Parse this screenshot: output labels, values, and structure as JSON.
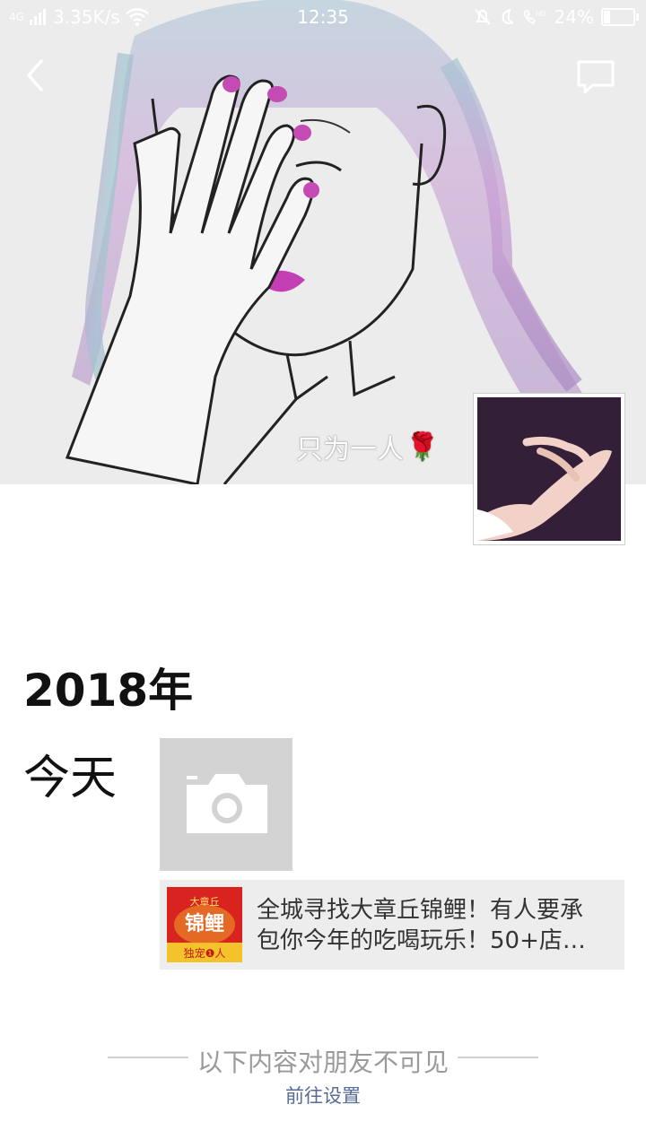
{
  "status_bar": {
    "network": "4G",
    "speed": "3.35K/s",
    "time": "12:35",
    "battery": "24%",
    "battery_level": 0.24,
    "icons": [
      "signal-icon",
      "wifi-icon",
      "mute-bell-icon",
      "moon-icon",
      "hd-call-icon",
      "battery-icon"
    ]
  },
  "header": {
    "back_icon": "back-chevron-icon",
    "message_icon": "message-icon"
  },
  "cover": {
    "signature": "只为一人",
    "signature_emoji": "🌹"
  },
  "timeline": {
    "year": "2018年",
    "today_label": "今天",
    "camera_icon": "camera-icon",
    "share": {
      "thumb_top": "大章丘",
      "thumb_main": "锦鲤",
      "thumb_bottom": "独宠❶人",
      "line1": "全城寻找大章丘锦鲤！有人要承",
      "line2": "包你今年的吃喝玩乐！50+店…"
    }
  },
  "footer": {
    "notice": "以下内容对朋友不可见",
    "settings_link": "前往设置"
  },
  "colors": {
    "link": "#576b95",
    "card_bg": "#ededed",
    "photo_placeholder": "#d3d3d3"
  }
}
